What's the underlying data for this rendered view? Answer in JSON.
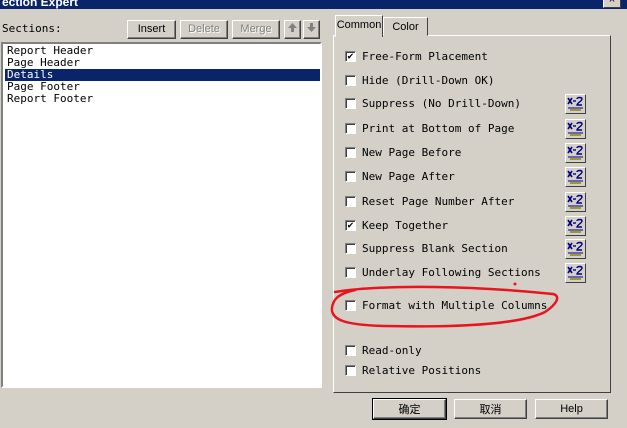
{
  "window": {
    "title": "ection Expert",
    "close_glyph": "×"
  },
  "sections_panel": {
    "label": "Sections:",
    "buttons": {
      "insert": "Insert",
      "delete": "Delete",
      "merge": "Merge"
    },
    "items": [
      {
        "label": "Report Header",
        "selected": false
      },
      {
        "label": "Page Header",
        "selected": false
      },
      {
        "label": "Details",
        "selected": true
      },
      {
        "label": "Page Footer",
        "selected": false
      },
      {
        "label": "Report Footer",
        "selected": false
      }
    ]
  },
  "tabs": [
    {
      "label": "Common",
      "active": true
    },
    {
      "label": "Color",
      "active": false
    }
  ],
  "options": [
    {
      "label": "Free-Form Placement",
      "checked": true,
      "formula": false
    },
    {
      "label": "Hide (Drill-Down OK)",
      "checked": false,
      "formula": false
    },
    {
      "label": "Suppress (No Drill-Down)",
      "checked": false,
      "formula": true
    },
    {
      "label": "Print at Bottom of Page",
      "checked": false,
      "formula": true
    },
    {
      "label": "New Page Before",
      "checked": false,
      "formula": true
    },
    {
      "label": "New Page After",
      "checked": false,
      "formula": true
    },
    {
      "label": "Reset Page Number After",
      "checked": false,
      "formula": true
    },
    {
      "label": "Keep Together",
      "checked": true,
      "formula": true
    },
    {
      "label": "Suppress Blank Section",
      "checked": false,
      "formula": true
    },
    {
      "label": "Underlay Following Sections",
      "checked": false,
      "formula": true
    },
    {
      "label": "Format with Multiple Columns",
      "checked": false,
      "formula": false
    },
    {
      "label": "Read-only",
      "checked": false,
      "formula": false
    },
    {
      "label": "Relative Positions",
      "checked": false,
      "formula": false
    }
  ],
  "footer_buttons": {
    "ok": "确定",
    "cancel": "取消",
    "help": "Help"
  },
  "colors": {
    "titlebar": "#0a246a",
    "selection": "#0a246a",
    "face": "#d4d0c8",
    "annotation": "#e8141e"
  }
}
